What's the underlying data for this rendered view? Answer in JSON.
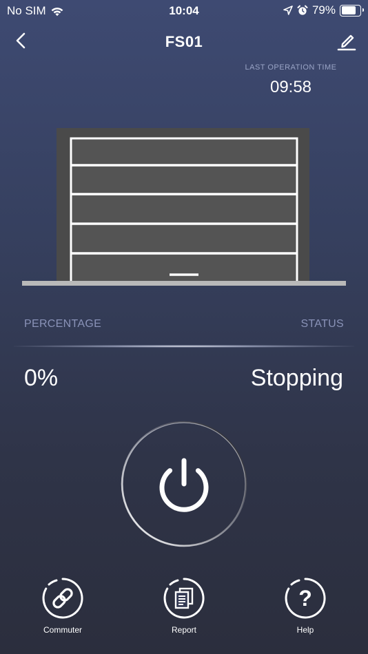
{
  "status_bar": {
    "carrier": "No SIM",
    "time": "10:04",
    "battery": "79%",
    "battery_level": 0.79,
    "icons": [
      "wifi-icon",
      "location-arrow-icon",
      "alarm-icon",
      "battery-icon"
    ]
  },
  "header": {
    "title": "FS01",
    "back_icon": "chevron-left-icon",
    "edit_icon": "pencil-icon"
  },
  "last_operation": {
    "label": "LAST OPERATION TIME",
    "value": "09:58"
  },
  "door": {
    "open_fraction": 0,
    "panel_count": 5
  },
  "metrics": {
    "percentage_label": "PERCENTAGE",
    "status_label": "STATUS",
    "percentage_value": "0%",
    "status_value": "Stopping"
  },
  "power": {
    "icon": "power-icon"
  },
  "bottom_nav": [
    {
      "label": "Commuter",
      "icon": "link-icon"
    },
    {
      "label": "Report",
      "icon": "document-icon"
    },
    {
      "label": "Help",
      "icon": "question-icon"
    }
  ],
  "colors": {
    "accent_text": "#8a93b8",
    "door_frame": "#4a4a4a",
    "door_panel": "#545454",
    "panel_line": "#ffffff",
    "floor": "#b9b9b9"
  }
}
